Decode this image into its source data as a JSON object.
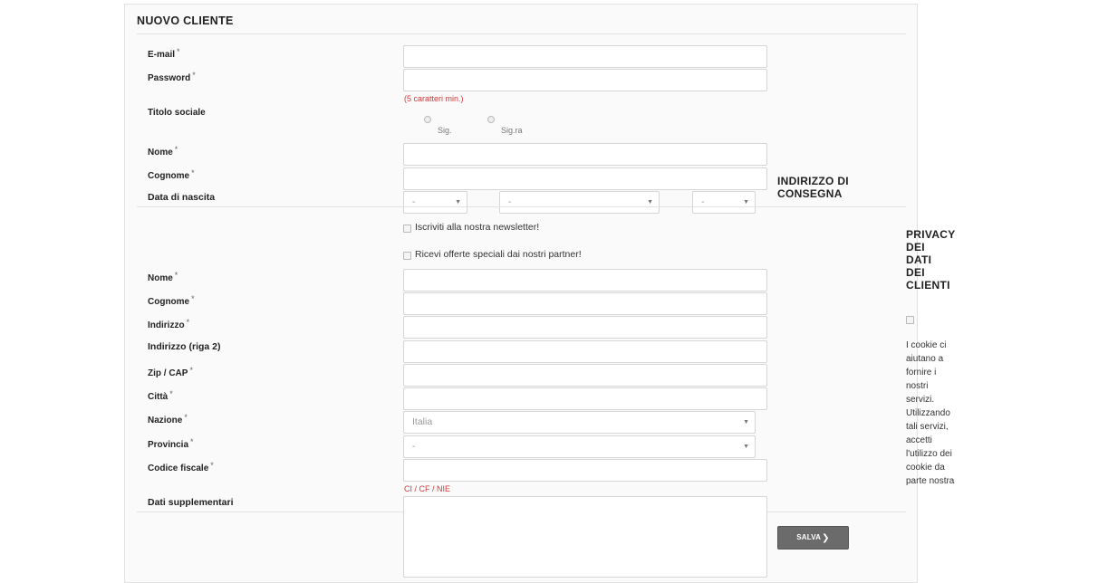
{
  "form": {
    "title": "NUOVO CLIENTE",
    "required_mark": "*",
    "email_label": "E-mail",
    "password_label": "Password",
    "password_hint": "(5 caratteri min.)",
    "title_label": "Titolo sociale",
    "title_options": [
      "Sig.",
      "Sig.ra"
    ],
    "firstname_label": "Nome",
    "lastname_label": "Cognome",
    "birthdate_label": "Data di nascita",
    "birth_day_value": "-",
    "birth_month_value": "-",
    "birth_year_value": "-",
    "newsletter_label": "Iscriviti alla nostra newsletter!",
    "optin_label": "Ricevi offerte speciali dai nostri partner!"
  },
  "address": {
    "title_line1": "INDIRIZZO DI",
    "title_line2": "CONSEGNA",
    "firstname_label": "Nome",
    "lastname_label": "Cognome",
    "address_label": "Indirizzo",
    "address2_label": "Indirizzo (riga 2)",
    "zip_label": "Zip / CAP",
    "city_label": "Città",
    "country_label": "Nazione",
    "country_value": "Italia",
    "state_label": "Provincia",
    "state_value": "-",
    "dni_label": "Codice fiscale",
    "dni_hint": "CI / CF / NIE",
    "other_label": "Dati supplementari"
  },
  "privacy": {
    "title_lines": [
      "PRIVACY",
      "DEI",
      "DATI",
      "DEI",
      "CLIENTI"
    ],
    "cookie_lines": [
      "I cookie ci",
      "aiutano a",
      "fornire i",
      "nostri",
      "servizi.",
      "Utilizzando",
      "tali servizi,",
      "accetti",
      "l'utilizzo dei",
      "cookie da",
      "parte nostra"
    ]
  },
  "actions": {
    "save_label": "SALVA",
    "save_chevron": "❯"
  }
}
